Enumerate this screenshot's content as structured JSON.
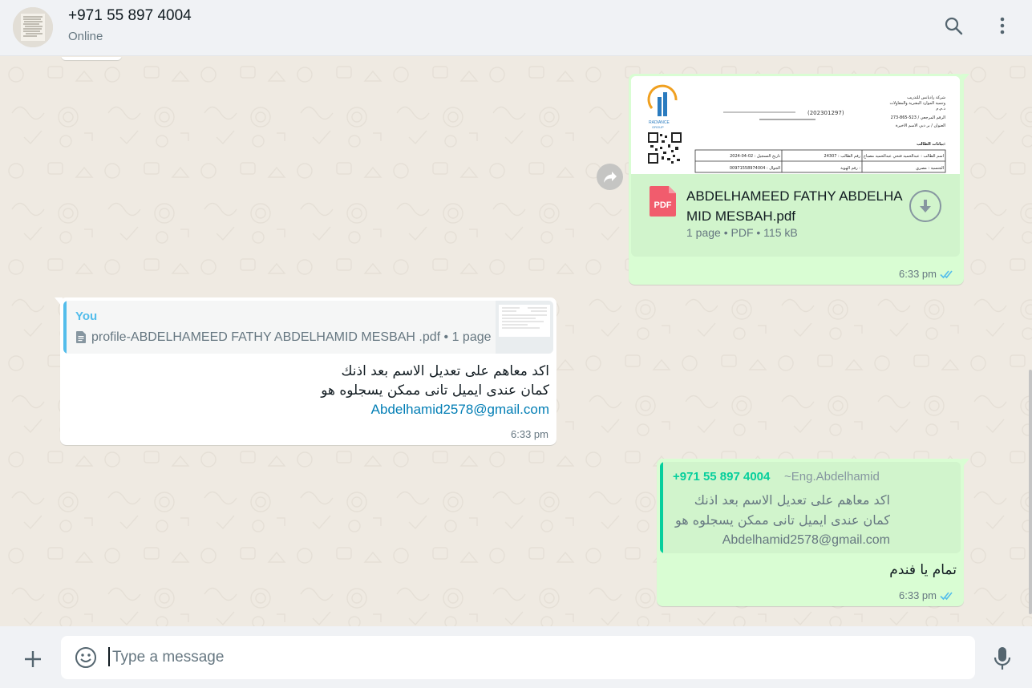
{
  "header": {
    "contact_name": "+971 55 897 4004",
    "status": "Online",
    "icons": {
      "search": "search-icon",
      "menu": "kebab-menu-icon"
    }
  },
  "messages": {
    "doc_message": {
      "file_name": "ABDELHAMEED FATHY ABDELHAMID MESBAH.pdf",
      "file_name_line1": "ABDELHAMEED FATHY ABDELHA",
      "file_name_line2": "MID MESBAH.pdf",
      "file_type_badge": "PDF",
      "meta": "1 page • PDF • 115 kB",
      "time": "6:33 pm",
      "status": "read",
      "preview": {
        "logo_text": "RADIANCE GROUP",
        "ref_number": "(202301297)",
        "header_lines": [
          "شركة راديانس للتدريب",
          "وتنمية الموارد البشرية والمقاولات",
          "ذ.م.م"
        ],
        "phone": "273-865-523 / الرقم المرجعي",
        "address": "العنوان / بر دبي الاسم الاخيرة",
        "section_title": "بيانات الطالب:",
        "table_rows": [
          [
            "اسم الطالب : عبدالحميد فتحي عبدالحميد مصباح",
            "رقم الطالب : 24307",
            "تاريخ التسجيل : 02-04-2024"
          ],
          [
            "الجنسية : مصري",
            "رقم الهوية :",
            "الجوال : 00971558974004"
          ]
        ]
      }
    },
    "incoming_reply": {
      "quote_author": "You",
      "quote_text": "profile-ABDELHAMEED FATHY ABDELHAMID MESBAH .pdf • 1 page",
      "line1": "اكد معاهم على تعديل الاسم بعد اذنك",
      "line2": "كمان عندى ايميل تانى ممكن يسجلوه هو",
      "email": "Abdelhamid2578@gmail.com",
      "time": "6:33 pm"
    },
    "outgoing_reply": {
      "quote_author": "+971 55 897 4004",
      "quote_push_name": "~Eng.Abdelhamid",
      "quote_line1": "اكد معاهم على تعديل الاسم بعد اذنك",
      "quote_line2": "كمان عندى ايميل تانى ممكن يسجلوه هو",
      "quote_line3": "Abdelhamid2578@gmail.com",
      "text": "تمام يا فندم",
      "time": "6:33 pm",
      "status": "read"
    }
  },
  "composer": {
    "placeholder": "Type a message",
    "icons": {
      "attach": "plus-icon",
      "emoji": "emoji-icon",
      "voice": "microphone-icon"
    }
  },
  "colors": {
    "outgoing_bubble": "#d9fdd3",
    "incoming_bubble": "#ffffff",
    "chat_background": "#efeae2",
    "accent_green": "#06cf9c",
    "you_blue": "#53bdeb",
    "read_ticks": "#53bdeb",
    "pdf_red": "#f15c6d"
  }
}
